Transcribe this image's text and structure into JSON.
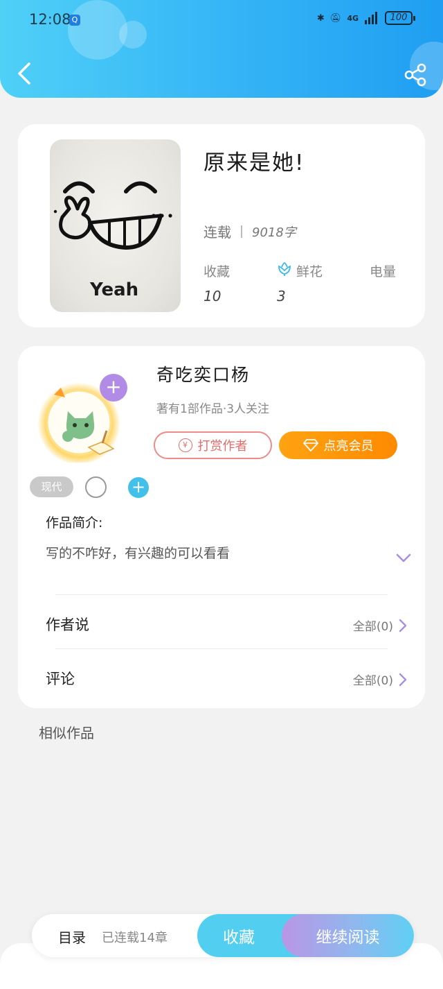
{
  "status_bar": {
    "time": "12:08",
    "network": "4G",
    "battery": "100"
  },
  "book": {
    "title": "原来是她!",
    "status": "连载",
    "word_count": "9018字",
    "stats": [
      {
        "label": "收藏",
        "value": "10"
      },
      {
        "label": "鲜花",
        "value": "3"
      },
      {
        "label": "电量",
        "value": ""
      }
    ],
    "cover_text": "Yeah"
  },
  "author": {
    "name": "奇吃奕口杨",
    "meta": "著有1部作品·3人关注",
    "tip_label": "打赏作者",
    "tip_icon_glyph": "¥",
    "vip_label": "点亮会员"
  },
  "tags": {
    "first": "现代",
    "add_glyph": "+"
  },
  "intro": {
    "label": "作品简介:",
    "text": "写的不咋好，有兴趣的可以看看"
  },
  "rows": {
    "author_says": {
      "label": "作者说",
      "count": "全部(0)"
    },
    "comments": {
      "label": "评论",
      "count": "全部(0)"
    }
  },
  "similar": {
    "title": "相似作品"
  },
  "bottom_bar": {
    "toc_label": "目录",
    "toc_meta": "已连载14章",
    "collect_label": "收藏",
    "read_label": "继续阅读"
  },
  "colors": {
    "header_start": "#4fd0f7",
    "header_end": "#1f9ef2",
    "vip_orange": "#ff8a00",
    "tip_red": "#e36c6a",
    "accent_purple": "#a98fe0",
    "accent_blue": "#41c0ea"
  }
}
